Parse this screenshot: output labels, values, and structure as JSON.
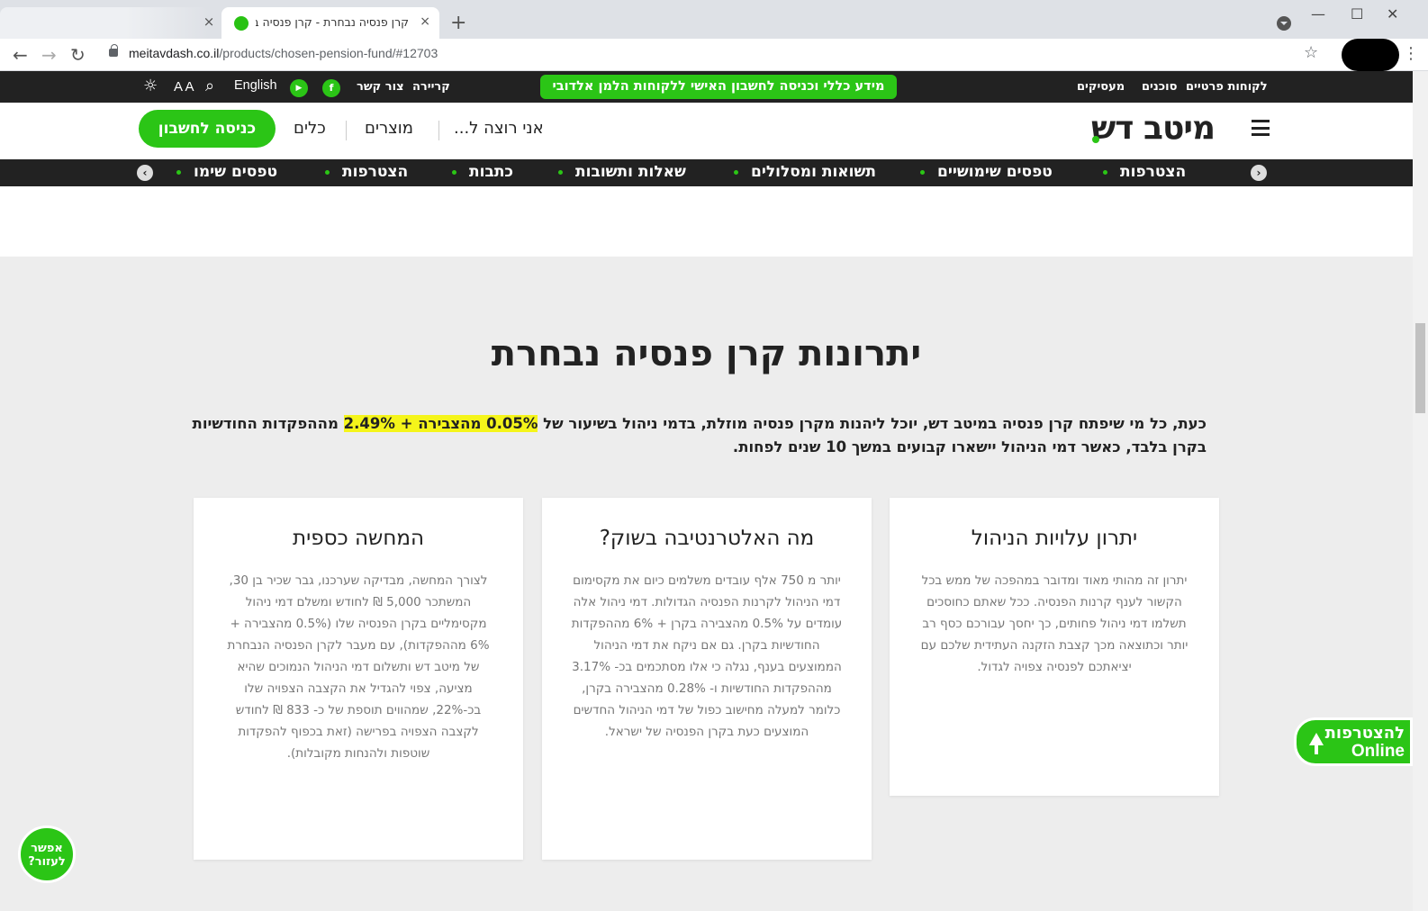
{
  "browser": {
    "tab_title": "קרן פנסיה נבחרת - קרן פנסיה בר",
    "tab_close": "×",
    "new_tab": "+",
    "url_domain": "meitavdash.co.il",
    "url_path": "/products/chosen-pension-fund/#12703",
    "back": "←",
    "forward": "→",
    "reload": "↻",
    "star": "☆",
    "menu": "⋮",
    "minimize": "—",
    "maximize": "☐",
    "close": "✕"
  },
  "topbar": {
    "links": [
      "לקוחות פרטיים",
      "סוכנים",
      "מעסיקים"
    ],
    "promo": "מידע כללי וכניסה לחשבון האישי ללקוחות הלמן אלדובי",
    "reception": "קריירה",
    "contact": "צור קשר",
    "facebook": "f",
    "youtube": "▶",
    "english": "English",
    "font_size": "A A",
    "search_icon": "⌕",
    "contrast_icon": "☼"
  },
  "header": {
    "logo": "מיטב דש",
    "i_want": "אני רוצה ל...",
    "products": "מוצרים",
    "tools": "כלים",
    "cta": "כניסה לחשבון"
  },
  "subnav": {
    "items": [
      "הצטרפות",
      "טפסים שימושיים",
      "תשואות ומסלולים",
      "שאלות ותשובות",
      "כתבות",
      "הצטרפות",
      "טפסים שימו"
    ],
    "prev": "‹",
    "next": "›"
  },
  "main": {
    "title": "יתרונות קרן פנסיה נבחרת",
    "intro_before": "כעת, כל מי שיפתח קרן פנסיה במיטב דש, יוכל ליהנות מקרן פנסיה מוזלת, בדמי ניהול בשיעור של ",
    "intro_highlight": "0.05% מהצבירה + 2.49%",
    "intro_after": " מההפקדות החודשיות בקרן בלבד, כאשר דמי הניהול יישארו קבועים במשך 10 שנים לפחות.",
    "cards": [
      {
        "title": "יתרון עלויות הניהול",
        "text": "יתרון זה מהותי מאוד ומדובר במהפכה של ממש בכל הקשור לענף קרנות הפנסיה. ככל שאתם כחוסכים תשלמו דמי ניהול פחותים, כך יחסך עבורכם כסף רב יותר וכתוצאה מכך קצבת הזקנה העתידית שלכם עם יציאתכם לפנסיה צפויה לגדול."
      },
      {
        "title": "מה האלטרנטיבה בשוק?",
        "text": "יותר מ 750 אלף עובדים משלמים כיום את מקסימום דמי הניהול לקרנות הפנסיה הגדולות. דמי ניהול אלה עומדים על 0.5% מהצבירה בקרן + 6% מההפקדות החודשיות בקרן. גם אם ניקח את דמי הניהול הממוצעים בענף, נגלה כי אלו מסתכמים בכ- 3.17% מההפקדות החודשיות ו- 0.28% מהצבירה בקרן, כלומר למעלה מחישוב כפול של דמי הניהול החדשים המוצעים כעת בקרן הפנסיה של ישראל."
      },
      {
        "title": "המחשה כספית",
        "text": "לצורך המחשה, מבדיקה שערכנו, גבר שכיר בן 30, המשתכר 5,000 ₪ לחודש ומשלם דמי ניהול מקסימליים בקרן הפנסיה שלו (0.5% מהצבירה + 6% מההפקדות), עם מעבר לקרן הפנסיה הנבחרת של מיטב דש ותשלום דמי הניהול הנמוכים שהיא מציעה, צפוי להגדיל את הקצבה הצפויה שלו בכ-22%, שמהווים תוספת של כ- 833 ₪ לחודש לקצבה הצפויה בפרישה (זאת בכפוף להפקדות שוטפות ולהנחות מקובלות)."
      }
    ]
  },
  "floating": {
    "online_top": "להצטרפות",
    "online_bottom": "Online",
    "help": "אפשר לעזור?"
  },
  "colors": {
    "brand_green": "#2bc516",
    "dark": "#222222",
    "highlight": "#f5f51a"
  }
}
